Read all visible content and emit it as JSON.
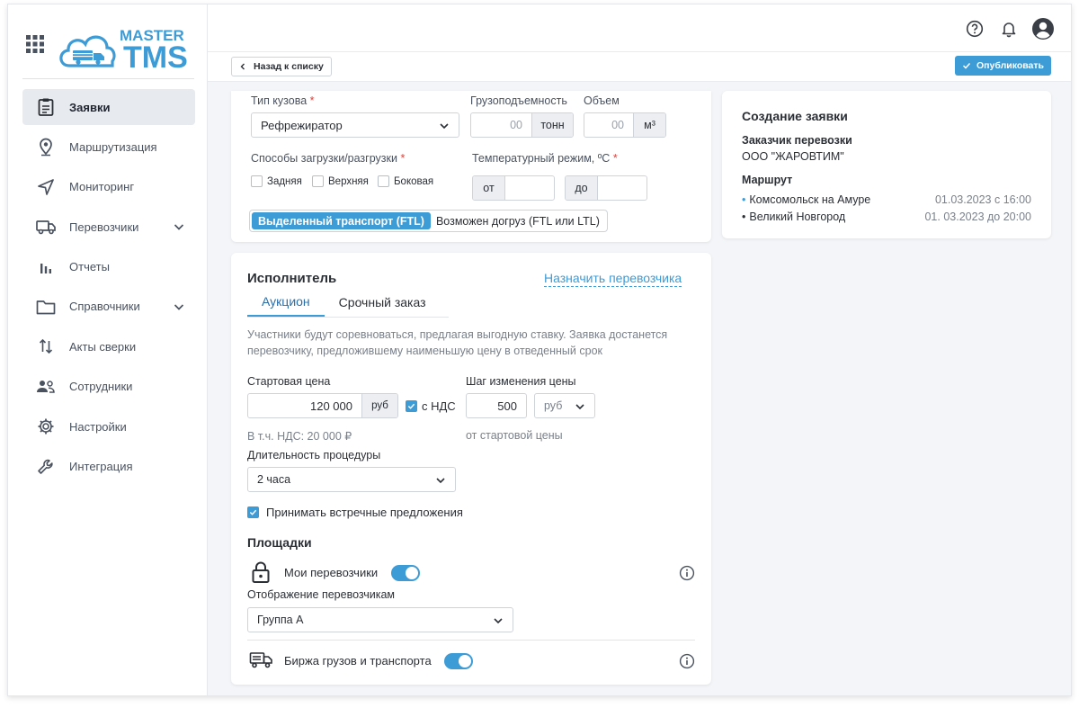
{
  "brand": {
    "logo_text_1": "MASTER",
    "logo_text_2": "TMS",
    "accent": "#3d9bd6"
  },
  "sidebar": {
    "items": [
      {
        "label": "Заявки",
        "icon": "clipboard-icon",
        "active": true
      },
      {
        "label": "Маршрутизация",
        "icon": "map-pin-icon"
      },
      {
        "label": "Мониторинг",
        "icon": "navigation-arrow-icon"
      },
      {
        "label": "Перевозчики",
        "icon": "truck-icon",
        "expandable": true
      },
      {
        "label": "Отчеты",
        "icon": "bar-chart-icon"
      },
      {
        "label": "Справочники",
        "icon": "folder-icon",
        "expandable": true
      },
      {
        "label": "Акты сверки",
        "icon": "swap-vertical-icon"
      },
      {
        "label": "Сотрудники",
        "icon": "users-icon"
      },
      {
        "label": "Настройки",
        "icon": "gear-icon"
      },
      {
        "label": "Интеграция",
        "icon": "wrench-icon"
      }
    ]
  },
  "actionbar": {
    "back_label": "Назад к списку",
    "publish_label": "Опубликовать"
  },
  "cargo": {
    "body_type_label": "Тип кузова",
    "body_type_value": "Рефрежиратор",
    "capacity_label": "Грузоподъемность",
    "capacity_value": "00",
    "capacity_unit": "тонн",
    "volume_label": "Объем",
    "volume_value": "00",
    "volume_unit": "м³",
    "loading_label": "Способы загрузки/разгрузки",
    "loading_options": [
      "Задняя",
      "Верхняя",
      "Боковая"
    ],
    "temp_label": "Температурный режим, ºС",
    "temp_from": "от",
    "temp_to": "до",
    "transport_on": "Выделенный транспорт (FTL)",
    "transport_off": "Возможен догруз (FTL или LTL)"
  },
  "executor": {
    "title": "Исполнитель",
    "assign_link": "Назначить перевозчика",
    "tabs": [
      "Аукцион",
      "Срочный заказ"
    ],
    "description": "Участники будут соревноваться, предлагая выгодную ставку. Заявка достанется перевозчику, предложившему наименьшую цену в отведенный срок",
    "start_price_label": "Стартовая цена",
    "start_price_value": "120 000",
    "start_price_unit": "руб",
    "vat_label": "с НДС",
    "vat_note": "В т.ч. НДС: 20 000 ₽",
    "step_label": "Шаг изменения цены",
    "step_value": "500",
    "step_unit": "руб",
    "step_note": "от стартовой цены",
    "duration_label": "Длительность процедуры",
    "duration_value": "2 часа",
    "counter_offers_label": "Принимать встречные предложения",
    "platforms_title": "Площадки",
    "my_carriers_label": "Мои перевозчики",
    "display_label": "Отображение перевозчикам",
    "display_value": "Группа А",
    "exchange_label": "Биржа грузов и транспорта"
  },
  "summary": {
    "title": "Создание заявки",
    "customer_label": "Заказчик перевозки",
    "customer_value": "ООО \"ЖАРОВТИМ\"",
    "route_label": "Маршрут",
    "route": [
      {
        "city": "Комсомольск на Амуре",
        "date": "01.03.2023 с 16:00"
      },
      {
        "city": "Великий Новгород",
        "date": "01. 03.2023 до 20:00"
      }
    ]
  }
}
